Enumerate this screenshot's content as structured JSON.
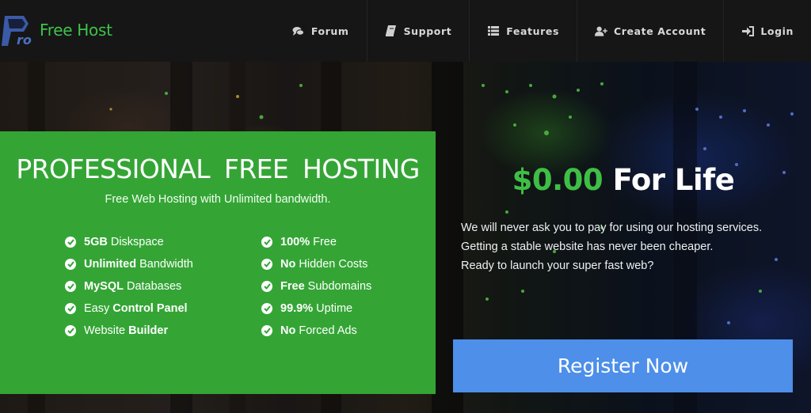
{
  "brand": {
    "name": "Free Host",
    "logo_text": "ro",
    "logo_icon": "pro-logo-icon"
  },
  "nav": {
    "items": [
      {
        "label": "Forum",
        "icon": "comments-icon"
      },
      {
        "label": "Support",
        "icon": "book-icon"
      },
      {
        "label": "Features",
        "icon": "list-icon"
      },
      {
        "label": "Create Account",
        "icon": "user-plus-icon"
      },
      {
        "label": "Login",
        "icon": "sign-in-icon"
      }
    ]
  },
  "promo": {
    "title": "PROFESSIONAL FREE HOSTING",
    "subtitle": "Free Web Hosting with Unlimited bandwidth.",
    "features_left": [
      {
        "bold": "5GB",
        "text": "Diskspace",
        "bold_first": true
      },
      {
        "bold": "Unlimited",
        "text": "Bandwidth",
        "bold_first": true
      },
      {
        "bold": "MySQL",
        "text": "Databases",
        "bold_first": true
      },
      {
        "bold": "Control Panel",
        "text": "Easy",
        "bold_first": false
      },
      {
        "bold": "Builder",
        "text": "Website",
        "bold_first": false
      }
    ],
    "features_right": [
      {
        "bold": "100%",
        "text": "Free",
        "bold_first": true
      },
      {
        "bold": "No",
        "text": "Hidden Costs",
        "bold_first": true
      },
      {
        "bold": "Free",
        "text": "Subdomains",
        "bold_first": true
      },
      {
        "bold": "99.9%",
        "text": "Uptime",
        "bold_first": true
      },
      {
        "bold": "No",
        "text": "Forced Ads",
        "bold_first": true
      }
    ]
  },
  "offer": {
    "amount": "$0.00",
    "suffix": "For Life",
    "lines": [
      "We will never ask you to pay for using our hosting services.",
      "Getting a stable website has never been cheaper.",
      "Ready to launch your super fast web?"
    ],
    "cta_label": "Register Now"
  },
  "colors": {
    "brand_green": "#3ec24a",
    "panel_green": "#34a535",
    "cta_blue": "#4d8fe9",
    "nav_bg": "#161616"
  }
}
